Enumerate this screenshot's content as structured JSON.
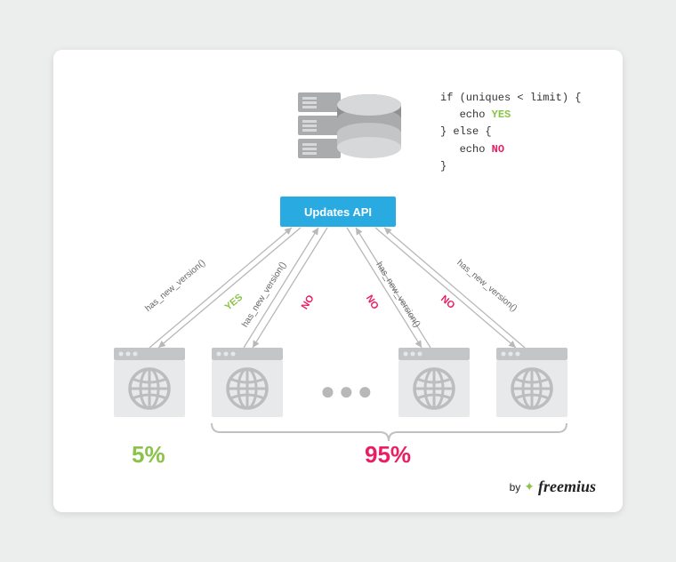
{
  "api_label": "Updates API",
  "code": {
    "l1": "if (uniques < limit) {",
    "l2": "echo",
    "l2y": "YES",
    "l3": "} else {",
    "l4": "echo",
    "l4n": "NO",
    "l5": "}"
  },
  "call_label": "has_new_version()",
  "responses": {
    "yes": "YES",
    "no": "NO"
  },
  "percent_yes": "5%",
  "percent_no": "95%",
  "byline": {
    "prefix": "by",
    "brand": "freemius"
  },
  "dots": "●●●"
}
